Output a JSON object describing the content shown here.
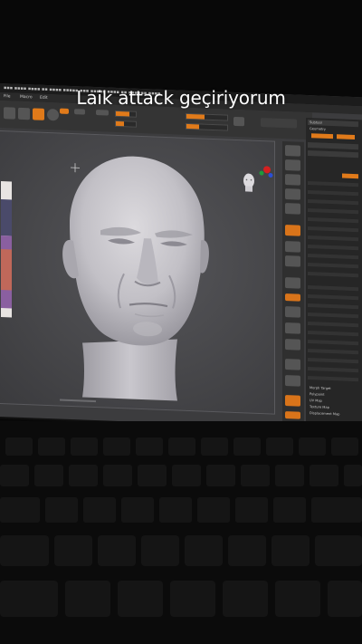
{
  "caption": "Laik attack geçiriyorum",
  "menu": [
    "File",
    "Macro",
    "Edit"
  ],
  "palette_items": [
    "Subtool",
    "Geometry",
    "",
    "",
    "Morph Target",
    "Polypaint",
    "UV Map",
    "Texture Map",
    "Displacement Map"
  ],
  "colors": {
    "accent": "#e07a1a",
    "screen_bg": "#3c3c3e",
    "model": "#c9c7cc",
    "caption": "#ffffff"
  },
  "icons": [
    "head-thumbnail-icon",
    "orientation-gizmo-icon",
    "crosshair-icon"
  ]
}
